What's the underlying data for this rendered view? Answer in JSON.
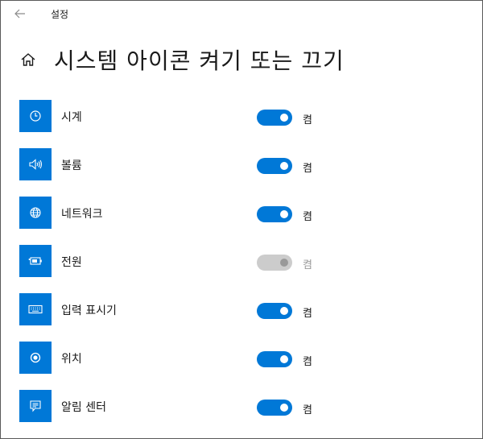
{
  "titlebar": {
    "title": "설정",
    "back_icon": "back-arrow-icon"
  },
  "header": {
    "home_icon": "home-icon",
    "title": "시스템 아이콘 켜기 또는 끄기"
  },
  "colors": {
    "accent": "#0078d7",
    "toggle_disabled": "#cccccc",
    "text_disabled": "#9a9a9a"
  },
  "items": [
    {
      "label": "시계",
      "icon": "clock-icon",
      "state": "켬",
      "on": true,
      "enabled": true
    },
    {
      "label": "볼륨",
      "icon": "volume-icon",
      "state": "켬",
      "on": true,
      "enabled": true
    },
    {
      "label": "네트워크",
      "icon": "globe-icon",
      "state": "켬",
      "on": true,
      "enabled": true
    },
    {
      "label": "전원",
      "icon": "battery-icon",
      "state": "켬",
      "on": true,
      "enabled": false
    },
    {
      "label": "입력 표시기",
      "icon": "keyboard-icon",
      "state": "켬",
      "on": true,
      "enabled": true
    },
    {
      "label": "위치",
      "icon": "location-icon",
      "state": "켬",
      "on": true,
      "enabled": true
    },
    {
      "label": "알림 센터",
      "icon": "action-center-icon",
      "state": "켬",
      "on": true,
      "enabled": true
    }
  ]
}
